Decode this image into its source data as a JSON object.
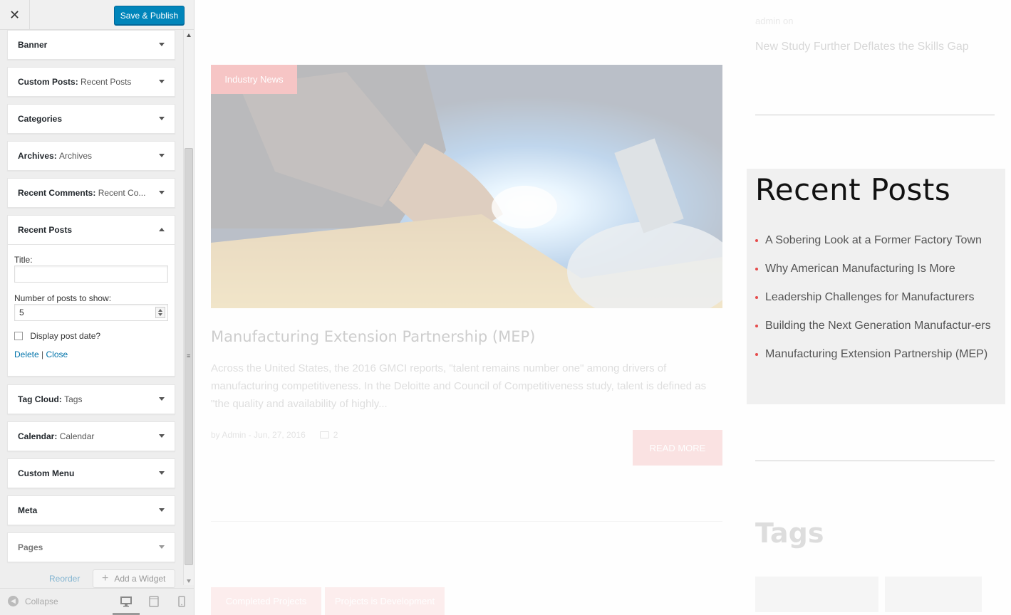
{
  "sidebar": {
    "close_label": "✕",
    "publish_label": "Save & Publish",
    "widgets": [
      {
        "name": "Banner",
        "sub": ""
      },
      {
        "name": "Custom Posts",
        "sub": "Recent Posts"
      },
      {
        "name": "Categories",
        "sub": ""
      },
      {
        "name": "Archives",
        "sub": "Archives"
      },
      {
        "name": "Recent Comments",
        "sub": "Recent Co..."
      },
      {
        "name": "Recent Posts",
        "sub": ""
      },
      {
        "name": "Tag Cloud",
        "sub": "Tags"
      },
      {
        "name": "Calendar",
        "sub": "Calendar"
      },
      {
        "name": "Custom Menu",
        "sub": ""
      },
      {
        "name": "Meta",
        "sub": ""
      },
      {
        "name": "Pages",
        "sub": ""
      }
    ],
    "form": {
      "title_label": "Title:",
      "title_value": "",
      "count_label": "Number of posts to show:",
      "count_value": "5",
      "date_label": "Display post date?",
      "date_checked": false,
      "delete_label": "Delete",
      "separator": "|",
      "close_label": "Close"
    },
    "reorder_label": "Reorder",
    "add_widget_label": "Add a Widget",
    "collapse_label": "Collapse",
    "active_device": "desktop"
  },
  "preview": {
    "category_badge": "Industry News",
    "post_title": "Manufacturing Extension Partnership (MEP)",
    "post_excerpt": "Across the United States, the 2016 GMCI reports, \"talent remains number one\" among drivers of manufacturing competitiveness. In the Deloitte and Council of Competitiveness study, talent is defined as \"the quality and availability of highly...",
    "post_meta": "by Admin - Jun, 27, 2016",
    "comment_count": "2",
    "read_more": "READ MORE",
    "post_tags": [
      "Completed Projects",
      "Projects is Development"
    ],
    "sidebar_top": {
      "meta": "admin on",
      "title": "New Study Further Deflates the Skills Gap"
    },
    "recent_posts": {
      "title": "Recent Posts",
      "items": [
        "A Sobering Look at a Former Factory Town",
        "Why American Manufacturing Is More",
        "Leadership Challenges for Manufacturers",
        "Building the Next Generation Manufactur-ers",
        "Manufacturing Extension Partnership (MEP)"
      ]
    },
    "tags_title": "Tags",
    "accent_color": "#e64b4b"
  }
}
